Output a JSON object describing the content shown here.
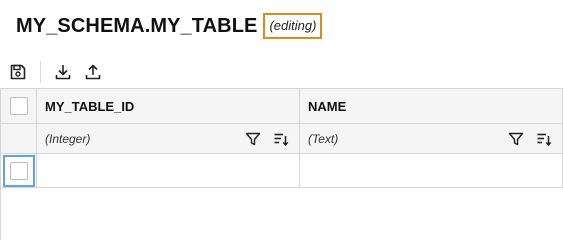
{
  "header": {
    "title": "MY_SCHEMA.MY_TABLE",
    "status_badge": "(editing)"
  },
  "toolbar": {
    "buttons": [
      {
        "name": "save",
        "icon": "save-icon"
      },
      {
        "name": "download",
        "icon": "download-icon"
      },
      {
        "name": "upload",
        "icon": "upload-icon"
      }
    ]
  },
  "grid": {
    "columns": [
      {
        "name": "MY_TABLE_ID",
        "type": "(Integer)"
      },
      {
        "name": "NAME",
        "type": "(Text)"
      }
    ],
    "rows": [
      [
        "",
        ""
      ]
    ]
  },
  "colors": {
    "badge_border": "#e08a1e",
    "focus_border": "#5aa6e6",
    "header_bg": "#f5f5f5",
    "grid_line": "#d6d6d6"
  }
}
